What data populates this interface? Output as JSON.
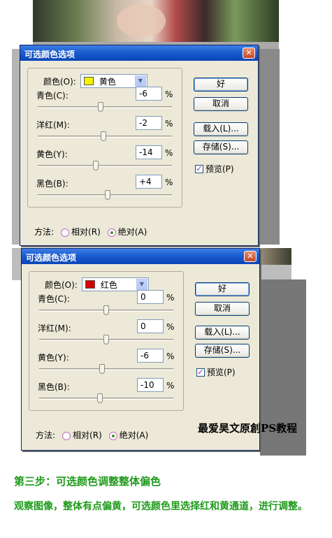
{
  "dialog1": {
    "title": "可选颜色选项",
    "color_label": "颜色(O):",
    "color_value": "黄色",
    "swatch_color": "#f5f000",
    "sliders": [
      {
        "label": "青色(C):",
        "value": "-6",
        "unit": "%",
        "level": 0.47
      },
      {
        "label": "洋红(M):",
        "value": "-2",
        "unit": "%",
        "level": 0.49
      },
      {
        "label": "黄色(Y):",
        "value": "-14",
        "unit": "%",
        "level": 0.43
      },
      {
        "label": "黑色(B):",
        "value": "+4",
        "unit": "%",
        "level": 0.52
      }
    ],
    "method_label": "方法:",
    "radio_relative": "相对(R)",
    "radio_absolute": "绝对(A)",
    "ok": "好",
    "cancel": "取消",
    "load": "载入(L)...",
    "save": "存储(S)...",
    "preview": "预览(P)"
  },
  "dialog2": {
    "title": "可选颜色选项",
    "color_label": "颜色(O):",
    "color_value": "红色",
    "swatch_color": "#d40000",
    "sliders": [
      {
        "label": "青色(C):",
        "value": "0",
        "unit": "%",
        "level": 0.5
      },
      {
        "label": "洋红(M):",
        "value": "0",
        "unit": "%",
        "level": 0.5
      },
      {
        "label": "黄色(Y):",
        "value": "-6",
        "unit": "%",
        "level": 0.47
      },
      {
        "label": "黑色(B):",
        "value": "-10",
        "unit": "%",
        "level": 0.45
      }
    ],
    "method_label": "方法:",
    "radio_relative": "相对(R)",
    "radio_absolute": "绝对(A)",
    "ok": "好",
    "cancel": "取消",
    "load": "载入(L)...",
    "save": "存储(S)...",
    "preview": "预览(P)"
  },
  "watermark": "最爱昊文原創PS教程",
  "step_title": "第三步：可选颜色调整整体偏色",
  "description": "观察图像，整体有点偏黄，可选颜色里选择红和黄通道，进行调整。",
  "accent_green": "#1e9a1a",
  "titlebar_blue": "#0a45b8"
}
